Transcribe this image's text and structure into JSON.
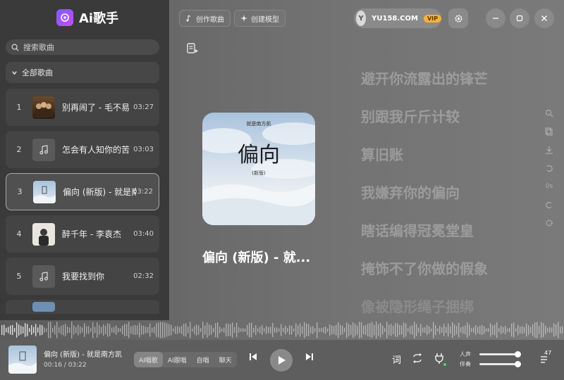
{
  "app": {
    "title": "Ai歌手"
  },
  "search": {
    "placeholder": "搜索歌曲"
  },
  "library": {
    "group_label": "全部歌曲"
  },
  "songs": [
    {
      "index": "1",
      "title": "别再闹了 - 毛不易",
      "duration": "03:27"
    },
    {
      "index": "2",
      "title": "怎会有人知你的苦",
      "duration": "03:03"
    },
    {
      "index": "3",
      "title": "偏向 (新版) - 就是南方凯",
      "duration": "03:22"
    },
    {
      "index": "4",
      "title": "醉千年 - 李袁杰",
      "duration": "03:40"
    },
    {
      "index": "5",
      "title": "我要找到你",
      "duration": "02:32"
    }
  ],
  "toolbar": {
    "create_song": "创作歌曲",
    "create_model": "创建模型"
  },
  "user": {
    "avatar_letter": "Y",
    "name": "YU158.COM",
    "badge": "VIP"
  },
  "now_playing": {
    "title": "偏向 (新版) - 就...",
    "full_title": "偏向 (新版) - 就是南方凯",
    "elapsed": "00:16",
    "total": "03:22",
    "time_text": "00:16 / 03:22",
    "cover_artist": "就是南方凯",
    "cover_title": "偏向",
    "cover_subtitle": "(新版)"
  },
  "lyrics": [
    "避开你流露出的锋芒",
    "别跟我斤斤计较",
    "算旧账",
    "我嫌弃你的偏向",
    "瞎话编得冠冕堂皇",
    "掩饰不了你做的假象",
    "像被隐形绳子捆绑"
  ],
  "side_tools": {
    "speed_label": "0s"
  },
  "modes": [
    {
      "label": "AI唱歌",
      "active": true
    },
    {
      "label": "AI跟唱",
      "active": false
    },
    {
      "label": "自唱",
      "active": false
    },
    {
      "label": "聊天",
      "active": false
    }
  ],
  "player": {
    "lyrics_toggle": "词",
    "vocal_label": "人声",
    "accomp_label": "伴奏",
    "queue_count": "47"
  },
  "colors": {
    "vip_gold": "#f3b23b",
    "logo_purple": "#7a5cff",
    "sidebar_bg": "#3a3a3a"
  }
}
